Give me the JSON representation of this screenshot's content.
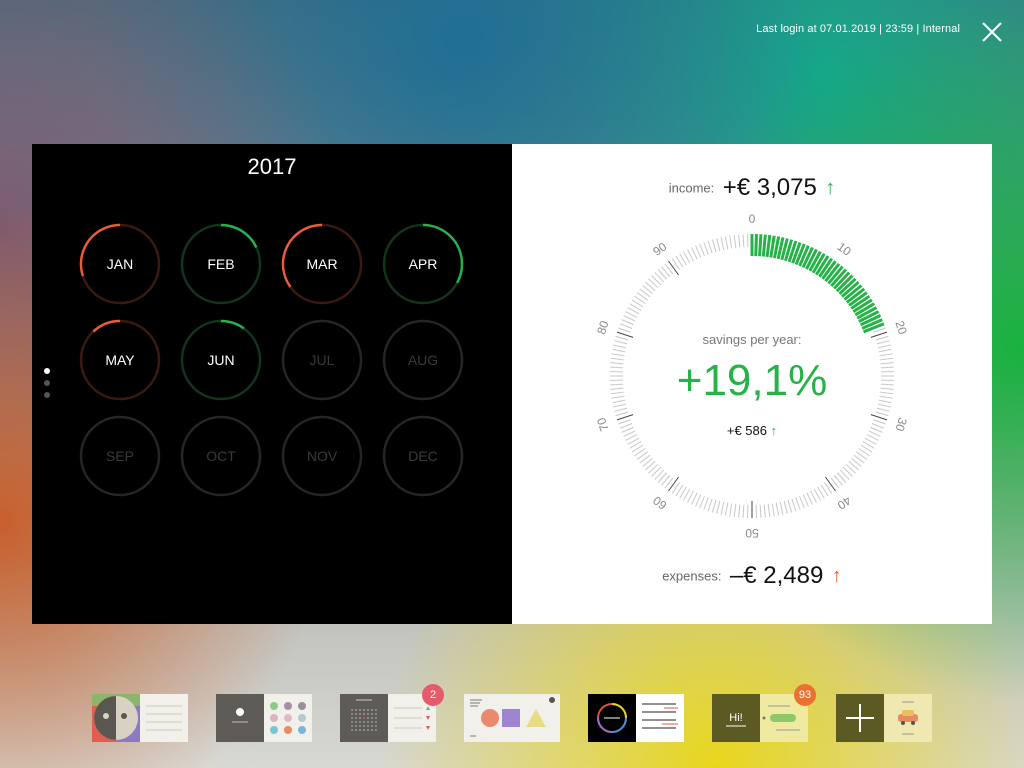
{
  "header": {
    "last_login": "Last login at 07.01.2019 | 23:59 | Internal",
    "close_icon": "close-icon"
  },
  "calendar": {
    "year": "2017",
    "page_dots": 3,
    "active_page": 0,
    "months": [
      {
        "label": "JAN",
        "status": "negative",
        "progress": 0.3,
        "active": true
      },
      {
        "label": "FEB",
        "status": "positive",
        "progress": 0.18,
        "active": true
      },
      {
        "label": "MAR",
        "status": "negative",
        "progress": 0.35,
        "active": true
      },
      {
        "label": "APR",
        "status": "positive",
        "progress": 0.33,
        "active": true
      },
      {
        "label": "MAY",
        "status": "negative",
        "progress": 0.12,
        "active": true
      },
      {
        "label": "JUN",
        "status": "positive",
        "progress": 0.1,
        "active": true
      },
      {
        "label": "JUL",
        "status": "none",
        "progress": 0,
        "active": false
      },
      {
        "label": "AUG",
        "status": "none",
        "progress": 0,
        "active": false
      },
      {
        "label": "SEP",
        "status": "none",
        "progress": 0,
        "active": false
      },
      {
        "label": "OCT",
        "status": "none",
        "progress": 0,
        "active": false
      },
      {
        "label": "NOV",
        "status": "none",
        "progress": 0,
        "active": false
      },
      {
        "label": "DEC",
        "status": "none",
        "progress": 0,
        "active": false
      }
    ]
  },
  "summary": {
    "income_label": "income:",
    "income_value": "+€ 3,075",
    "income_arrow": "↑",
    "savings_label": "savings per year:",
    "savings_pct": "+19,1%",
    "savings_amount": "+€ 586",
    "savings_arrow": "↑",
    "savings_value": 19.1,
    "gauge_labels": [
      "0",
      "10",
      "20",
      "30",
      "40",
      "50",
      "60",
      "70",
      "80",
      "90"
    ],
    "expenses_label": "expenses:",
    "expenses_value": "–€ 2,489",
    "expenses_arrow": "↑"
  },
  "colors": {
    "positive": "#26b248",
    "negative": "#ea5c33",
    "positive_track": "#12361d",
    "negative_track": "#3c1a12",
    "inactive_track": "#262626"
  },
  "dock": {
    "apps": [
      {
        "name": "app-people"
      },
      {
        "name": "app-dots"
      },
      {
        "name": "app-calendar",
        "badge": "2"
      },
      {
        "name": "app-shapes"
      },
      {
        "name": "app-finance"
      },
      {
        "name": "app-chat",
        "badge": "93"
      },
      {
        "name": "app-add-car"
      }
    ]
  }
}
